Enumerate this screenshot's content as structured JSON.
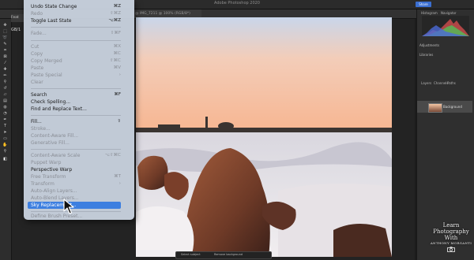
{
  "app": {
    "title": "Adobe Photoshop 2020",
    "share_label": "Share",
    "document_tab": "@ IMG_7211 @ 100% (RGB/8*)",
    "peek_tab": "Feat",
    "left_readout": "GB/1"
  },
  "menu": {
    "items": [
      {
        "label": "Undo State Change",
        "shortcut": "⌘Z",
        "enabled": true
      },
      {
        "label": "Redo",
        "shortcut": "⇧⌘Z",
        "enabled": false
      },
      {
        "label": "Toggle Last State",
        "shortcut": "⌥⌘Z",
        "enabled": true
      },
      {
        "label": "Fade...",
        "shortcut": "⇧⌘F",
        "enabled": false
      },
      {
        "label": "Cut",
        "shortcut": "⌘X",
        "enabled": false
      },
      {
        "label": "Copy",
        "shortcut": "⌘C",
        "enabled": false
      },
      {
        "label": "Copy Merged",
        "shortcut": "⇧⌘C",
        "enabled": false
      },
      {
        "label": "Paste",
        "shortcut": "⌘V",
        "enabled": false
      },
      {
        "label": "Paste Special",
        "shortcut": "›",
        "enabled": false
      },
      {
        "label": "Clear",
        "shortcut": "",
        "enabled": false
      },
      {
        "label": "Search",
        "shortcut": "⌘F",
        "enabled": true
      },
      {
        "label": "Check Spelling...",
        "shortcut": "",
        "enabled": true
      },
      {
        "label": "Find and Replace Text...",
        "shortcut": "",
        "enabled": true
      },
      {
        "label": "Fill...",
        "shortcut": "⇧",
        "enabled": true
      },
      {
        "label": "Stroke...",
        "shortcut": "",
        "enabled": false
      },
      {
        "label": "Content-Aware Fill...",
        "shortcut": "",
        "enabled": false
      },
      {
        "label": "Generative Fill...",
        "shortcut": "",
        "enabled": false
      },
      {
        "label": "Content-Aware Scale",
        "shortcut": "⌥⇧⌘C",
        "enabled": false
      },
      {
        "label": "Puppet Warp",
        "shortcut": "",
        "enabled": false
      },
      {
        "label": "Perspective Warp",
        "shortcut": "",
        "enabled": true
      },
      {
        "label": "Free Transform",
        "shortcut": "⌘T",
        "enabled": false
      },
      {
        "label": "Transform",
        "shortcut": "›",
        "enabled": false
      },
      {
        "label": "Auto-Align Layers...",
        "shortcut": "",
        "enabled": false
      },
      {
        "label": "Auto-Blend Layers...",
        "shortcut": "",
        "enabled": false
      },
      {
        "label": "Sky Replacement...",
        "shortcut": "",
        "enabled": true,
        "highlighted": true
      },
      {
        "label": "Define Brush Preset...",
        "shortcut": "",
        "enabled": false
      }
    ]
  },
  "panels": {
    "tabs": [
      "Histogram",
      "Navigator"
    ],
    "adjustments": "Adjustments",
    "libraries": "Libraries",
    "layer_tabs": [
      "Layers",
      "Channels",
      "Paths"
    ],
    "layer_name": "Background"
  },
  "context_bar": {
    "select_subject": "Select subject",
    "remove_background": "Remove background"
  },
  "watermark": {
    "line1": "Learn",
    "line2": "Photography",
    "line3": "With",
    "line4": "ANTHONY MORGANTI"
  },
  "colors": {
    "menu_bg": "#cdd7e4",
    "highlight": "#3d7fe0",
    "accent": "#3b6fd1"
  }
}
